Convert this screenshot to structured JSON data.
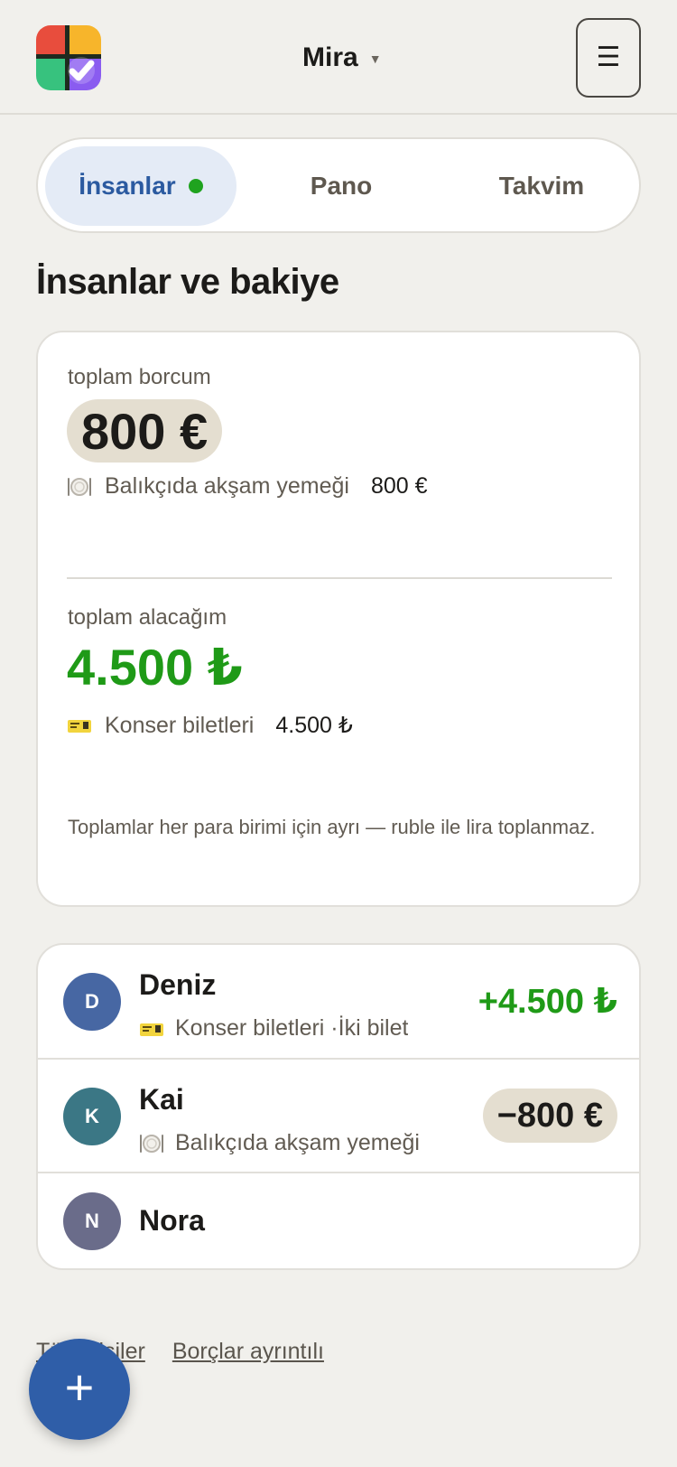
{
  "header": {
    "user_name": "Mira",
    "caret": "▼",
    "menu_icon": "☰"
  },
  "tabs": [
    {
      "label": "İnsanlar",
      "active": true,
      "has_dot": true
    },
    {
      "label": "Pano",
      "active": false
    },
    {
      "label": "Takvim",
      "active": false
    }
  ],
  "page": {
    "title": "İnsanlar ve bakiye"
  },
  "balance": {
    "owe_label": "toplam borcum",
    "owe_amount": "800 €",
    "owe_item": {
      "icon": "plate-cutlery-icon",
      "label": "Balıkçıda akşam yemeği",
      "amount": "800 €"
    },
    "receive_label": "toplam alacağım",
    "receive_amount": "4.500 ₺",
    "receive_item": {
      "icon": "ticket-icon",
      "label": "Konser biletleri",
      "amount": "4.500 ₺"
    },
    "note": "Toplamlar her para birimi için ayrı — ruble ile lira toplanmaz."
  },
  "people": [
    {
      "initial": "D",
      "name": "Deniz",
      "icon": "ticket-icon",
      "subtitle": "Konser biletleri ·İki bilet",
      "amount": "+4.500 ₺",
      "avatar_color": "#4767a3"
    },
    {
      "initial": "K",
      "name": "Kai",
      "icon": "plate-cutlery-icon",
      "subtitle": "Balıkçıda akşam yemeği",
      "amount": "−800 €",
      "avatar_color": "#3b7785"
    },
    {
      "initial": "N",
      "name": "Nora",
      "avatar_color": "#6a6c8a"
    }
  ],
  "links": {
    "contacts": "Tüm kişiler",
    "debts": "Borçlar ayrıntılı"
  },
  "fab": {
    "label": "+"
  },
  "colors": {
    "accent": "#2f5ea8",
    "positive": "#1f9a17",
    "owe_pill": "#e4ded0",
    "background": "#f1f0ec"
  }
}
